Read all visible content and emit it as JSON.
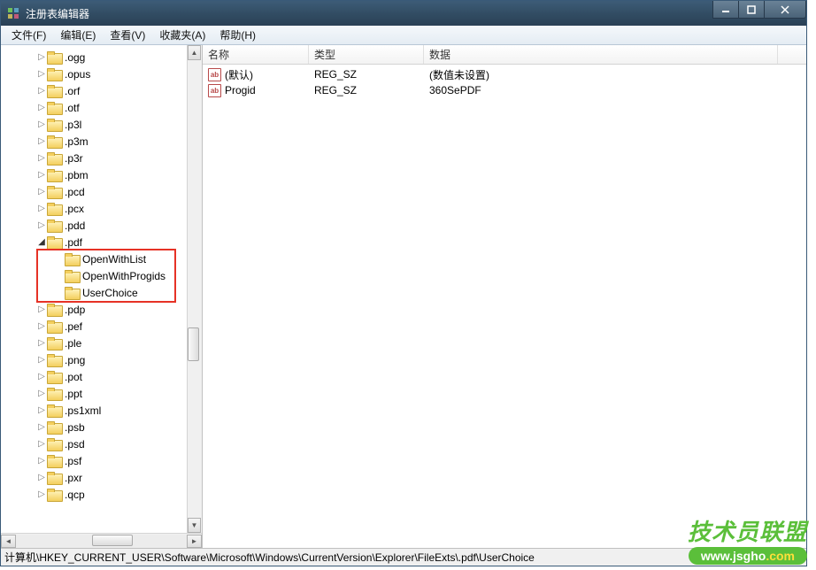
{
  "window": {
    "title": "注册表编辑器"
  },
  "menu": {
    "file": "文件(F)",
    "edit": "编辑(E)",
    "view": "查看(V)",
    "favorites": "收藏夹(A)",
    "help": "帮助(H)"
  },
  "tree": {
    "items": [
      {
        "indent": 40,
        "exp": "closed",
        "label": ".ogg"
      },
      {
        "indent": 40,
        "exp": "closed",
        "label": ".opus"
      },
      {
        "indent": 40,
        "exp": "closed",
        "label": ".orf"
      },
      {
        "indent": 40,
        "exp": "closed",
        "label": ".otf"
      },
      {
        "indent": 40,
        "exp": "closed",
        "label": ".p3l"
      },
      {
        "indent": 40,
        "exp": "closed",
        "label": ".p3m"
      },
      {
        "indent": 40,
        "exp": "closed",
        "label": ".p3r"
      },
      {
        "indent": 40,
        "exp": "closed",
        "label": ".pbm"
      },
      {
        "indent": 40,
        "exp": "closed",
        "label": ".pcd"
      },
      {
        "indent": 40,
        "exp": "closed",
        "label": ".pcx"
      },
      {
        "indent": 40,
        "exp": "closed",
        "label": ".pdd"
      },
      {
        "indent": 40,
        "exp": "open",
        "label": ".pdf"
      },
      {
        "indent": 60,
        "exp": "none",
        "label": "OpenWithList"
      },
      {
        "indent": 60,
        "exp": "none",
        "label": "OpenWithProgids"
      },
      {
        "indent": 60,
        "exp": "none",
        "label": "UserChoice"
      },
      {
        "indent": 40,
        "exp": "closed",
        "label": ".pdp"
      },
      {
        "indent": 40,
        "exp": "closed",
        "label": ".pef"
      },
      {
        "indent": 40,
        "exp": "closed",
        "label": ".ple"
      },
      {
        "indent": 40,
        "exp": "closed",
        "label": ".png"
      },
      {
        "indent": 40,
        "exp": "closed",
        "label": ".pot"
      },
      {
        "indent": 40,
        "exp": "closed",
        "label": ".ppt"
      },
      {
        "indent": 40,
        "exp": "closed",
        "label": ".ps1xml"
      },
      {
        "indent": 40,
        "exp": "closed",
        "label": ".psb"
      },
      {
        "indent": 40,
        "exp": "closed",
        "label": ".psd"
      },
      {
        "indent": 40,
        "exp": "closed",
        "label": ".psf"
      },
      {
        "indent": 40,
        "exp": "closed",
        "label": ".pxr"
      },
      {
        "indent": 40,
        "exp": "closed",
        "label": ".qcp"
      }
    ]
  },
  "list": {
    "columns": {
      "name": "名称",
      "type": "类型",
      "data": "数据"
    },
    "col_widths": {
      "name": 120,
      "type": 130,
      "data": 400
    },
    "rows": [
      {
        "name": "(默认)",
        "type": "REG_SZ",
        "data": "(数值未设置)"
      },
      {
        "name": "Progid",
        "type": "REG_SZ",
        "data": "360SePDF"
      }
    ]
  },
  "statusbar": {
    "path": "计算机\\HKEY_CURRENT_USER\\Software\\Microsoft\\Windows\\CurrentVersion\\Explorer\\FileExts\\.pdf\\UserChoice"
  },
  "watermark": {
    "line1": "技术员联盟",
    "url_a": "www.",
    "url_b": "jsgho",
    "url_c": ".com"
  }
}
